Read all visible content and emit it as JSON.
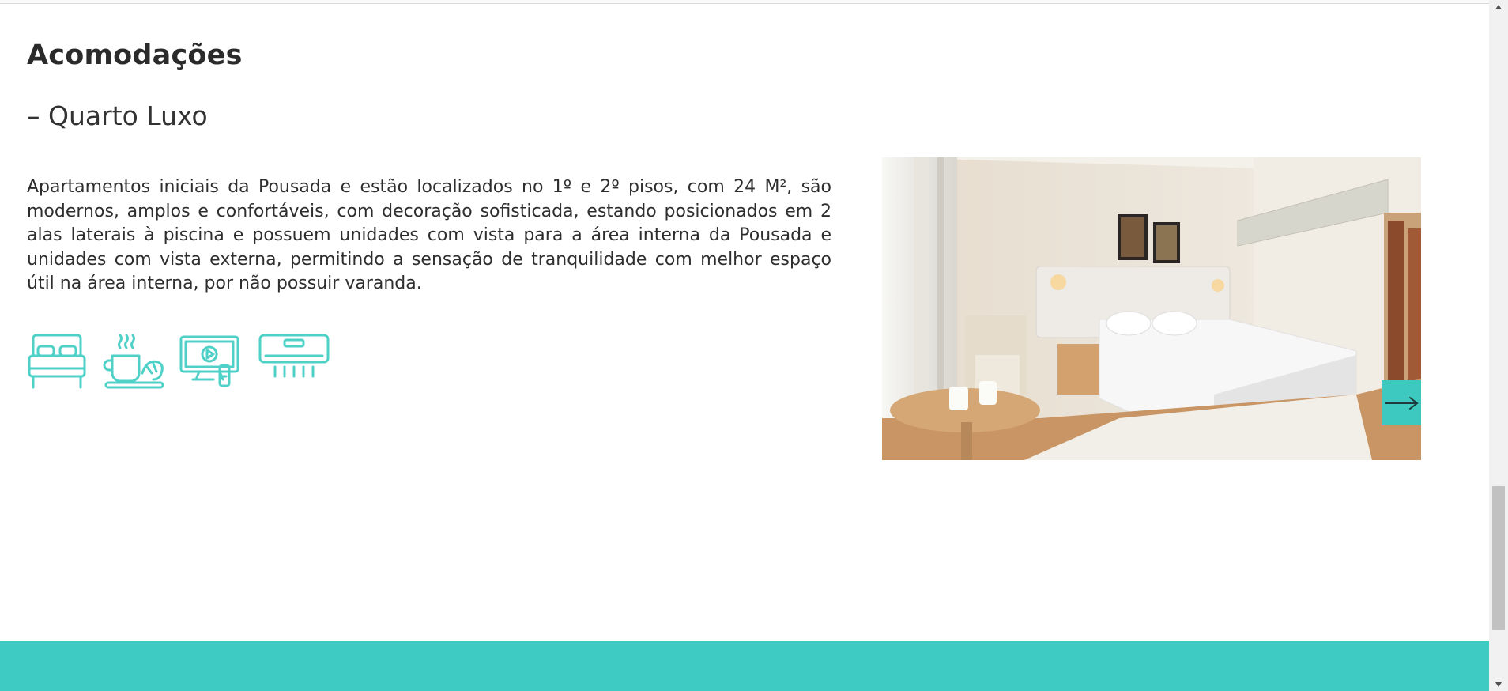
{
  "section": {
    "title": "Acomodações",
    "room_name": "– Quarto Luxo",
    "description": "Apartamentos iniciais da Pousada e estão localizados no 1º e 2º pisos, com 24 M², são modernos, amplos e confortáveis, com decoração sofisticada, estando posicionados em 2 alas laterais à piscina e possuem unidades com vista para a área interna da Pousada e unidades com vista externa, permitindo a sensação de tranquilidade com melhor espaço útil na área interna, por não possuir varanda."
  },
  "amenities": [
    {
      "icon": "bed-icon"
    },
    {
      "icon": "breakfast-icon"
    },
    {
      "icon": "tv-icon"
    },
    {
      "icon": "air-conditioner-icon"
    }
  ],
  "gallery": {
    "next_icon": "arrow-right-icon"
  },
  "colors": {
    "accent": "#3ecbc3",
    "text": "#2b2b2b",
    "icon": "#4fd1c8"
  }
}
